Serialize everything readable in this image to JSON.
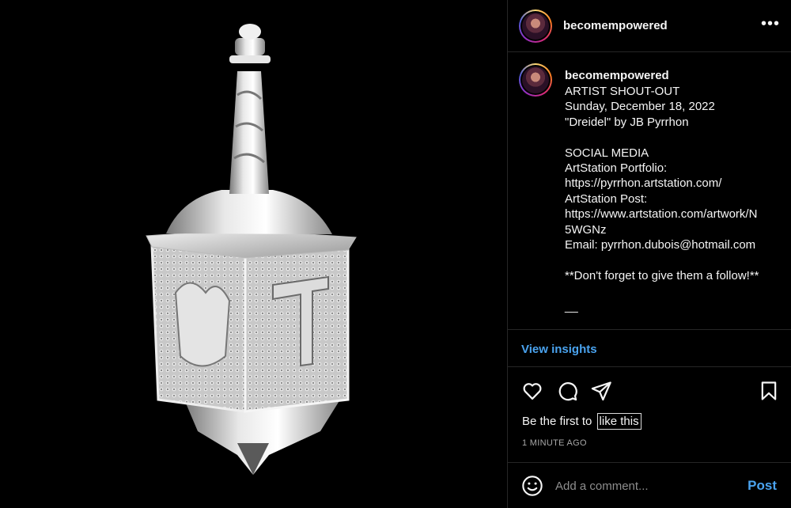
{
  "post": {
    "image_alt": "silver dreidel sculpture",
    "username": "becomempowered",
    "more_label": "•••"
  },
  "caption": {
    "username": "becomempowered",
    "lines": [
      "ARTIST SHOUT-OUT",
      "Sunday, December 18, 2022",
      "\"Dreidel\" by JB Pyrrhon",
      "",
      "SOCIAL MEDIA",
      "ArtStation Portfolio:",
      "https://pyrrhon.artstation.com/",
      "ArtStation Post:",
      "https://www.artstation.com/artwork/N",
      "5WGNz",
      "Email: pyrrhon.dubois@hotmail.com",
      "",
      "**Don't forget to give them a follow!**",
      "",
      "__"
    ]
  },
  "insights_label": "View insights",
  "actions": {
    "like_icon": "heart-icon",
    "comment_icon": "comment-icon",
    "share_icon": "send-icon",
    "save_icon": "bookmark-icon"
  },
  "likes": {
    "prefix": "Be the first to",
    "link": "like this"
  },
  "timestamp": "1 MINUTE AGO",
  "comment": {
    "placeholder": "Add a comment...",
    "post_label": "Post"
  },
  "colors": {
    "accent": "#4aa3ef",
    "background": "#000000",
    "divider": "#262626"
  }
}
